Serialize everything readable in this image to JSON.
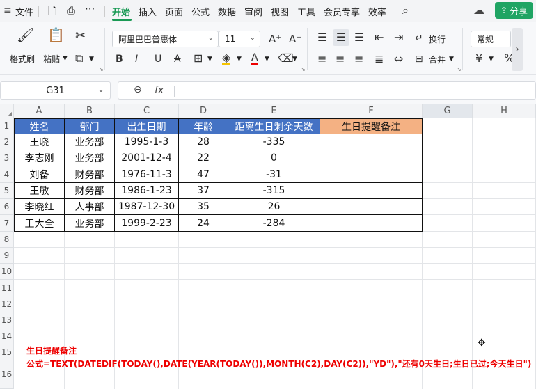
{
  "menubar": {
    "file_label": "文件",
    "tabs": [
      "开始",
      "插入",
      "页面",
      "公式",
      "数据",
      "审阅",
      "视图",
      "工具",
      "会员专享",
      "效率"
    ],
    "share_label": "分享"
  },
  "ribbon": {
    "format_painter": "格式刷",
    "paste": "粘贴",
    "font_name": "阿里巴巴普惠体",
    "font_size": "11",
    "wrap": "换行",
    "merge": "合并",
    "number_format": "常规"
  },
  "formula_bar": {
    "name_box": "G31",
    "fx": "fx",
    "formula": ""
  },
  "columns": [
    "A",
    "B",
    "C",
    "D",
    "E",
    "F",
    "G",
    "H"
  ],
  "rows": [
    "1",
    "2",
    "3",
    "4",
    "5",
    "6",
    "7",
    "8",
    "9",
    "10",
    "11",
    "12",
    "13",
    "14",
    "15",
    "16"
  ],
  "table": {
    "headers": [
      "姓名",
      "部门",
      "出生日期",
      "年龄",
      "距离生日剩余天数",
      "生日提醒备注"
    ],
    "rows": [
      [
        "王晓",
        "业务部",
        "1995-1-3",
        "28",
        "-335",
        ""
      ],
      [
        "李志刚",
        "业务部",
        "2001-12-4",
        "22",
        "0",
        ""
      ],
      [
        "刘备",
        "财务部",
        "1976-11-3",
        "47",
        "-31",
        ""
      ],
      [
        "王敏",
        "财务部",
        "1986-1-23",
        "37",
        "-315",
        ""
      ],
      [
        "李晓红",
        "人事部",
        "1987-12-30",
        "35",
        "26",
        ""
      ],
      [
        "王大全",
        "业务部",
        "1999-2-23",
        "24",
        "-284",
        ""
      ]
    ]
  },
  "notes": {
    "title": "生日提醒备注",
    "formula": "公式=TEXT(DATEDIF(TODAY(),DATE(YEAR(TODAY()),MONTH(C2),DAY(C2)),\"YD\"),\"还有0天生日;生日已过;今天生日\")"
  },
  "colors": {
    "header_blue": "#4472c4",
    "header_orange": "#f4b183",
    "accent_green": "#1a9a55",
    "note_red": "#ee0000"
  }
}
